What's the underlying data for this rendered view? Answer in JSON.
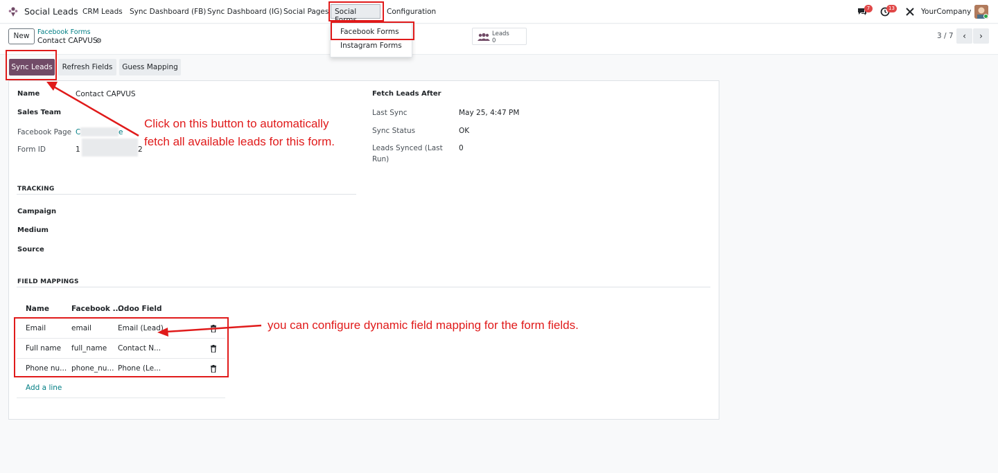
{
  "app": {
    "title": "Social Leads",
    "company": "YourCompany"
  },
  "nav": {
    "items": [
      "CRM Leads",
      "Sync Dashboard (FB)",
      "Sync Dashboard (IG)",
      "Social Pages",
      "Social Forms",
      "Configuration"
    ],
    "active": "Social Forms"
  },
  "systray": {
    "messages_badge": "7",
    "activities_badge": "13"
  },
  "dropdown": {
    "items": [
      "Facebook Forms",
      "Instagram Forms"
    ]
  },
  "control": {
    "new_label": "New",
    "breadcrumb_parent": "Facebook Forms",
    "breadcrumb_current": "Contact CAPVUS",
    "smart_button": {
      "label": "Leads",
      "count": "0"
    },
    "pager": "3 / 7"
  },
  "actions": {
    "sync": "Sync Leads",
    "refresh": "Refresh Fields",
    "guess": "Guess Mapping"
  },
  "form": {
    "name_label": "Name",
    "name_value": "Contact CAPVUS",
    "team_label": "Sales Team",
    "page_label": "Facebook Page",
    "page_value_start": "C",
    "page_value_end": "e",
    "formid_label": "Form ID",
    "formid_value_start": "1",
    "formid_value_end": "2",
    "fetch_label": "Fetch Leads After",
    "last_sync_label": "Last Sync",
    "last_sync_value": "May 25, 4:47 PM",
    "status_label": "Sync Status",
    "status_value": "OK",
    "synced_label_1": "Leads Synced (Last",
    "synced_label_2": "Run)",
    "synced_value": "0"
  },
  "tracking": {
    "title": "TRACKING",
    "campaign": "Campaign",
    "medium": "Medium",
    "source": "Source"
  },
  "mappings": {
    "title": "FIELD MAPPINGS",
    "headers": [
      "Name",
      "Facebook ...",
      "Odoo Field"
    ],
    "rows": [
      {
        "name": "Email",
        "fb": "email",
        "odoo": "Email (Lead)"
      },
      {
        "name": "Full name",
        "fb": "full_name",
        "odoo": "Contact N..."
      },
      {
        "name": "Phone nu...",
        "fb": "phone_nu...",
        "odoo": "Phone (Le..."
      }
    ],
    "add_line": "Add a line"
  },
  "annotations": {
    "note1_line1": "Click on this button to automatically",
    "note1_line2": "fetch all available leads for this form.",
    "note2": "you can configure dynamic field mapping for the form fields."
  },
  "colors": {
    "primary": "#714b67",
    "link": "#017e84",
    "annotation": "#e01a1a"
  }
}
